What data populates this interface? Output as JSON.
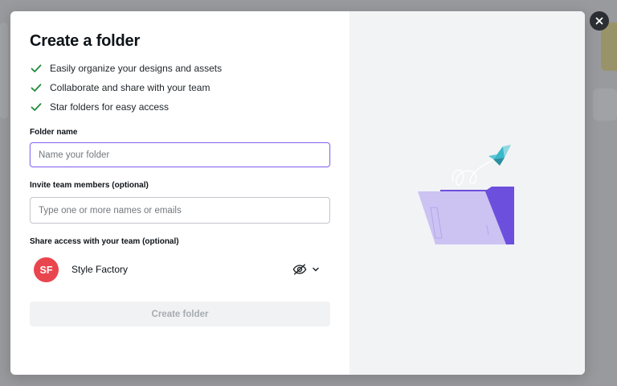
{
  "dialog": {
    "title": "Create a folder",
    "features": [
      "Easily organize your designs and assets",
      "Collaborate and share with your team",
      "Star folders for easy access"
    ],
    "folder_name": {
      "label": "Folder name",
      "placeholder": "Name your folder",
      "value": ""
    },
    "invite": {
      "label": "Invite team members (optional)",
      "placeholder": "Type one or more names or emails",
      "value": ""
    },
    "share": {
      "label": "Share access with your team (optional)",
      "team": {
        "initials": "SF",
        "name": "Style Factory"
      },
      "access_icon": "eye-hidden-icon",
      "dropdown_icon": "chevron-down-icon"
    },
    "create_button_label": "Create folder",
    "close_icon": "close-icon"
  },
  "colors": {
    "accent": "#8b6cef",
    "check": "#1e8c3a",
    "avatar": "#e9454e",
    "folder_front": "#ccc3f3",
    "folder_back": "#6d4fdd",
    "bird": "#39b8c9"
  }
}
